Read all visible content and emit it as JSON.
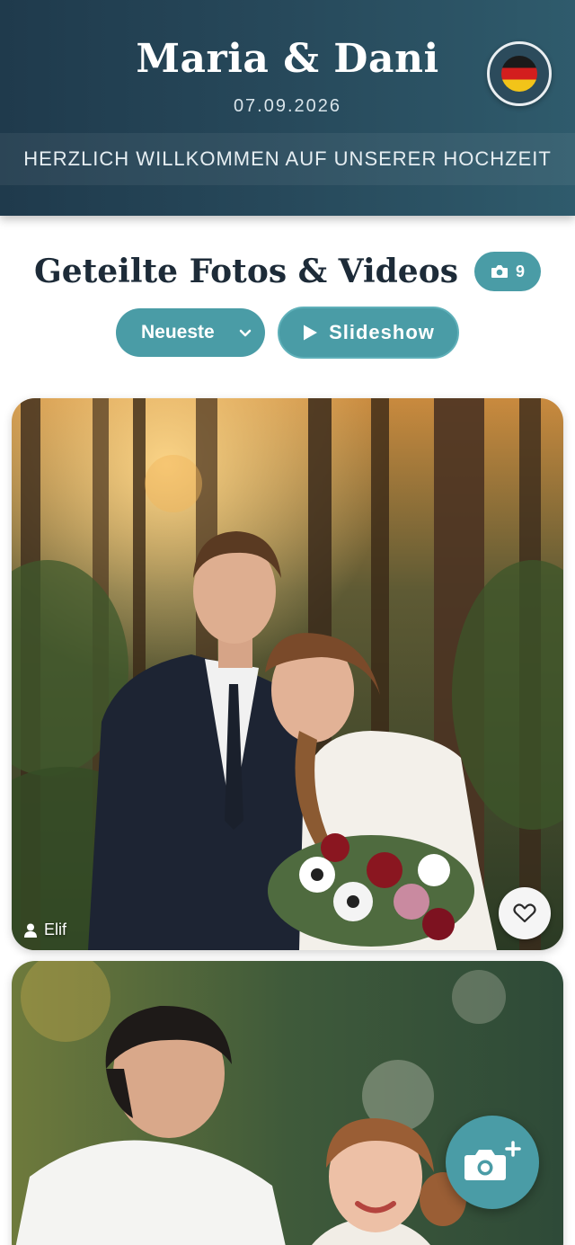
{
  "header": {
    "couple_names": "Maria & Dani",
    "date": "07.09.2026",
    "welcome": "HERZLICH WILLKOMMEN AUF UNSERER HOCHZEIT",
    "language_flag": "germany-flag-icon"
  },
  "gallery": {
    "title": "Geteilte Fotos & Videos",
    "count": "9",
    "sort": {
      "selected": "Neueste"
    },
    "slideshow_label": "Slideshow"
  },
  "photos": [
    {
      "uploader": "Elif",
      "scene": "couple in forest at sunset"
    },
    {
      "uploader": "",
      "scene": "couple facing each other outdoors"
    }
  ],
  "colors": {
    "header_bg": "#27495b",
    "accent": "#4a9ca6",
    "title_text": "#1d2b38"
  },
  "icons": {
    "count_icon": "camera-icon",
    "sort_icon": "chevron-down-icon",
    "slideshow_icon": "play-icon",
    "uploader_icon": "user-icon",
    "like_icon": "heart-icon",
    "fab_icon": "camera-plus-icon"
  }
}
